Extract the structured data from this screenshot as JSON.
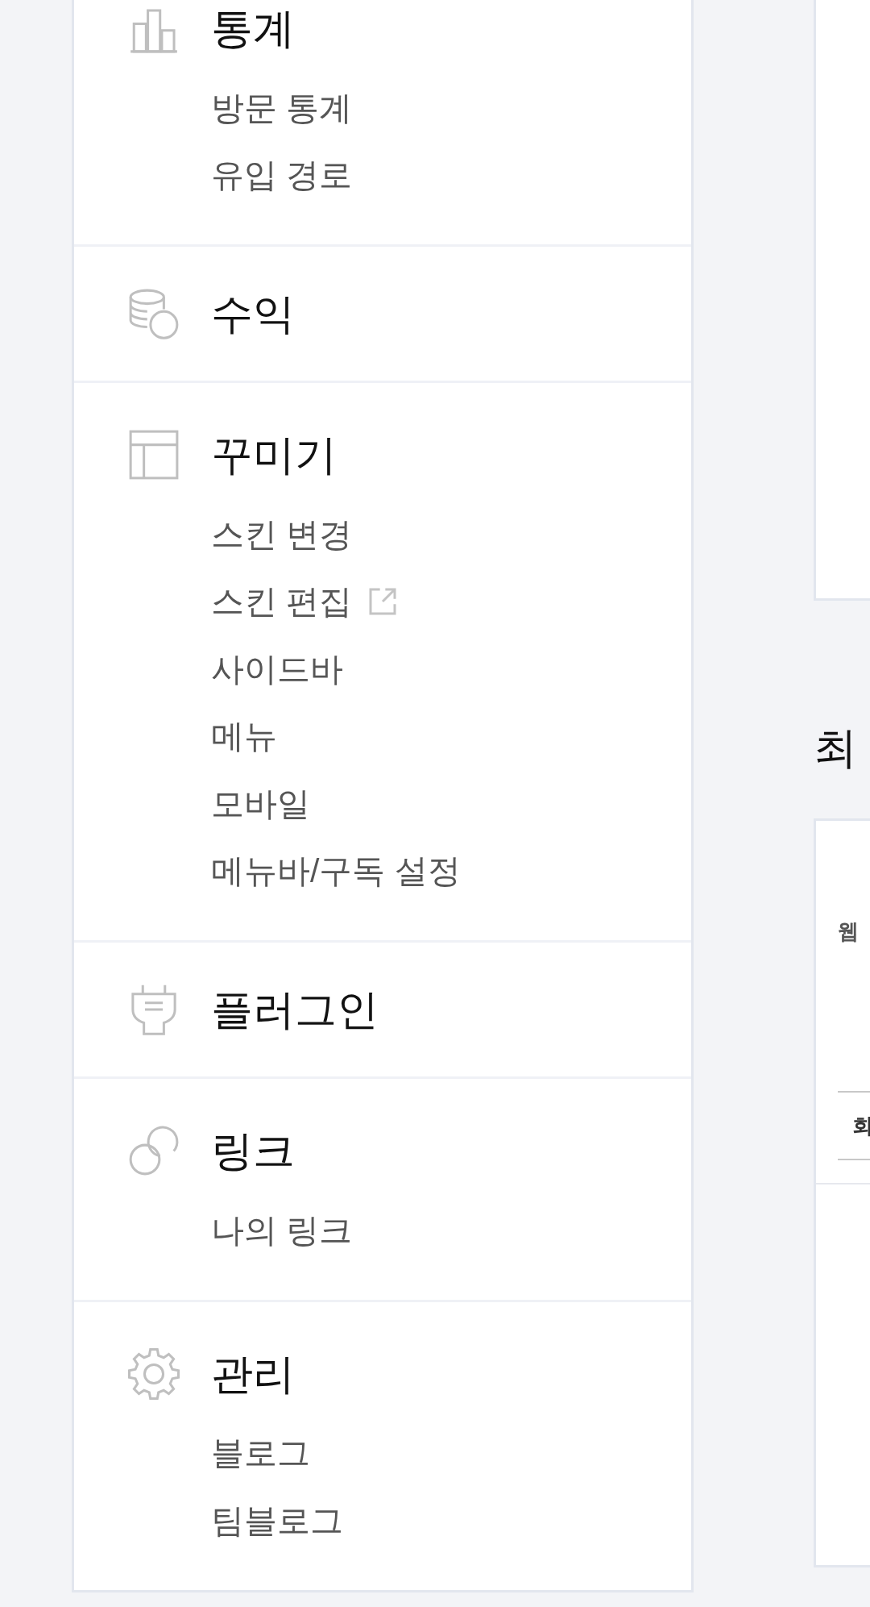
{
  "sidebar": {
    "sections": [
      {
        "title": "통계",
        "items": [
          {
            "label": "방문 통계",
            "external": false
          },
          {
            "label": "유입 경로",
            "external": false
          }
        ]
      },
      {
        "title": "수익"
      },
      {
        "title": "꾸미기",
        "items": [
          {
            "label": "스킨 변경",
            "external": false
          },
          {
            "label": "스킨 편집",
            "external": true
          },
          {
            "label": "사이드바",
            "external": false
          },
          {
            "label": "메뉴",
            "external": false
          },
          {
            "label": "모바일",
            "external": false
          },
          {
            "label": "메뉴바/구독 설정",
            "external": false
          }
        ]
      },
      {
        "title": "플러그인"
      },
      {
        "title": "링크",
        "items": [
          {
            "label": "나의 링크",
            "external": false
          }
        ]
      },
      {
        "title": "관리",
        "items": [
          {
            "label": "블로그",
            "external": false
          },
          {
            "label": "팀블로그",
            "external": false
          }
        ]
      }
    ]
  },
  "main": {
    "section_title": "최",
    "card": {
      "title": "웹",
      "rows": [
        {
          "label": "회"
        }
      ]
    }
  }
}
